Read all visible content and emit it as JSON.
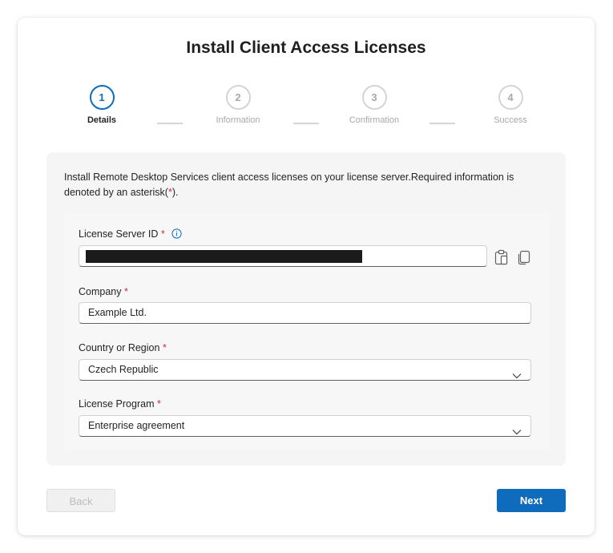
{
  "dialog": {
    "title": "Install Client Access Licenses"
  },
  "steps": [
    {
      "number": "1",
      "label": "Details",
      "active": true
    },
    {
      "number": "2",
      "label": "Information",
      "active": false
    },
    {
      "number": "3",
      "label": "Confirmation",
      "active": false
    },
    {
      "number": "4",
      "label": "Success",
      "active": false
    }
  ],
  "intro": {
    "text": "Install Remote Desktop Services client access licenses on your license server.Required information is denoted by an asterisk(",
    "asterisk": "*",
    "suffix": ")."
  },
  "form": {
    "required_marker": "*",
    "license_server_id": {
      "label": "License Server ID",
      "value_redacted": true,
      "paste_icon": "paste-icon",
      "copy_icon": "copy-icon",
      "info_icon": "info-icon"
    },
    "company": {
      "label": "Company",
      "value": "Example Ltd."
    },
    "country": {
      "label": "Country or Region",
      "value": "Czech Republic"
    },
    "license_program": {
      "label": "License Program",
      "value": "Enterprise agreement"
    }
  },
  "buttons": {
    "back": "Back",
    "next": "Next"
  },
  "colors": {
    "accent": "#0f6cbd",
    "required": "#c4314b",
    "redaction": "#1b1b1b"
  }
}
